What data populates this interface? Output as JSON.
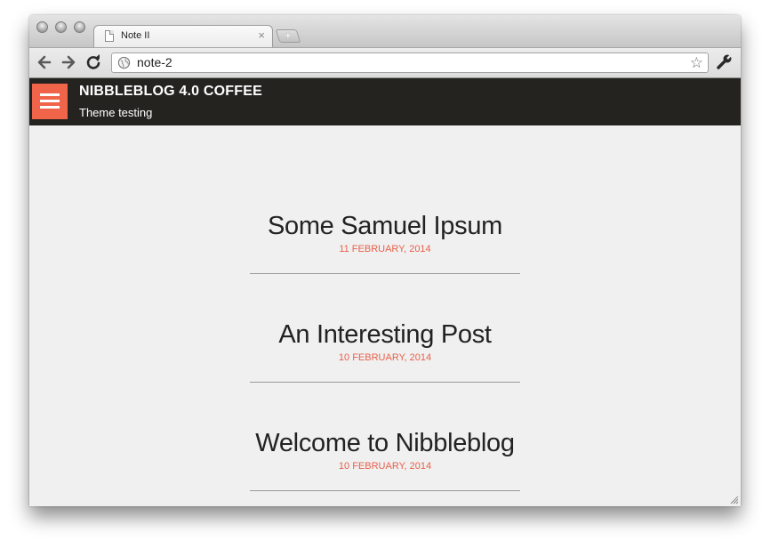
{
  "browser": {
    "tab_title": "Note II",
    "tab_close": "×",
    "new_tab": "+",
    "url": "note-2",
    "back_glyph": "←",
    "forward_glyph": "→",
    "reload_glyph": "C",
    "star_glyph": "☆"
  },
  "site": {
    "title": "NIBBLEBLOG 4.0 COFFEE",
    "subtitle": "Theme testing",
    "accent_color": "#f0644a",
    "header_color": "#252320"
  },
  "posts": [
    {
      "title": "Some Samuel Ipsum",
      "date": "11 FEBRUARY, 2014"
    },
    {
      "title": "An Interesting Post",
      "date": "10 FEBRUARY, 2014"
    },
    {
      "title": "Welcome to Nibbleblog",
      "date": "10 FEBRUARY, 2014"
    }
  ]
}
